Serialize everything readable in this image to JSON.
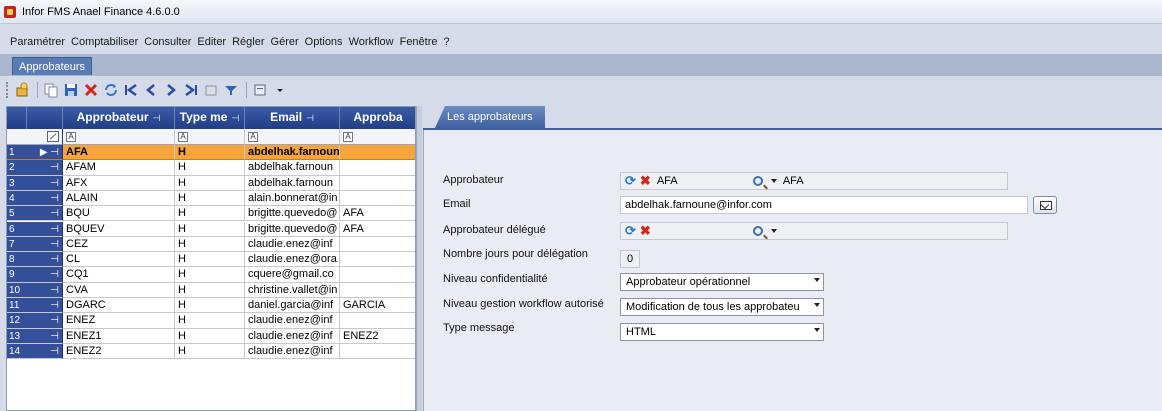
{
  "window": {
    "title": "Infor FMS Anael Finance 4.6.0.0"
  },
  "menu": [
    "Paramétrer",
    "Comptabiliser",
    "Consulter",
    "Editer",
    "Régler",
    "Gérer",
    "Options",
    "Workflow",
    "Fenêtre",
    "?"
  ],
  "doc_tab": "Approbateurs",
  "grid": {
    "columns": [
      "Approbateur",
      "Type me",
      "Email",
      "Approba"
    ],
    "filter_glyph": "A",
    "rows": [
      {
        "num": "1",
        "approbateur": "AFA",
        "type": "H",
        "email": "abdelhak.farnoun",
        "approba": ""
      },
      {
        "num": "2",
        "approbateur": "AFAM",
        "type": "H",
        "email": "abdelhak.farnoun",
        "approba": ""
      },
      {
        "num": "3",
        "approbateur": "AFX",
        "type": "H",
        "email": "abdelhak.farnoun",
        "approba": ""
      },
      {
        "num": "4",
        "approbateur": "ALAIN",
        "type": "H",
        "email": "alain.bonnerat@in",
        "approba": ""
      },
      {
        "num": "5",
        "approbateur": "BQU",
        "type": "H",
        "email": "brigitte.quevedo@",
        "approba": "AFA"
      },
      {
        "num": "6",
        "approbateur": "BQUEV",
        "type": "H",
        "email": "brigitte.quevedo@",
        "approba": "AFA"
      },
      {
        "num": "7",
        "approbateur": "CEZ",
        "type": "H",
        "email": "claudie.enez@inf",
        "approba": ""
      },
      {
        "num": "8",
        "approbateur": "CL",
        "type": "H",
        "email": "claudie.enez@ora",
        "approba": ""
      },
      {
        "num": "9",
        "approbateur": "CQ1",
        "type": "H",
        "email": "cquere@gmail.co",
        "approba": ""
      },
      {
        "num": "10",
        "approbateur": "CVA",
        "type": "H",
        "email": "christine.vallet@in",
        "approba": ""
      },
      {
        "num": "11",
        "approbateur": "DGARC",
        "type": "H",
        "email": "daniel.garcia@inf",
        "approba": "GARCIA"
      },
      {
        "num": "12",
        "approbateur": "ENEZ",
        "type": "H",
        "email": "claudie.enez@inf",
        "approba": ""
      },
      {
        "num": "13",
        "approbateur": "ENEZ1",
        "type": "H",
        "email": "claudie.enez@inf",
        "approba": "ENEZ2"
      },
      {
        "num": "14",
        "approbateur": "ENEZ2",
        "type": "H",
        "email": "claudie.enez@inf",
        "approba": ""
      }
    ]
  },
  "detail": {
    "tab": "Les approbateurs",
    "fields": {
      "approbateur": {
        "label": "Approbateur",
        "value": "AFA",
        "display": "AFA"
      },
      "email": {
        "label": "Email",
        "value": "abdelhak.farnoune@infor.com"
      },
      "delegue": {
        "label": "Approbateur délégué"
      },
      "nb_jours": {
        "label": "Nombre jours pour délégation",
        "value": "0"
      },
      "confidentialite": {
        "label": "Niveau confidentialité",
        "value": "Approbateur opérationnel"
      },
      "workflow": {
        "label": "Niveau gestion workflow autorisé",
        "value": "Modification de tous les approbateu"
      },
      "type_message": {
        "label": "Type message",
        "value": "HTML"
      }
    }
  }
}
